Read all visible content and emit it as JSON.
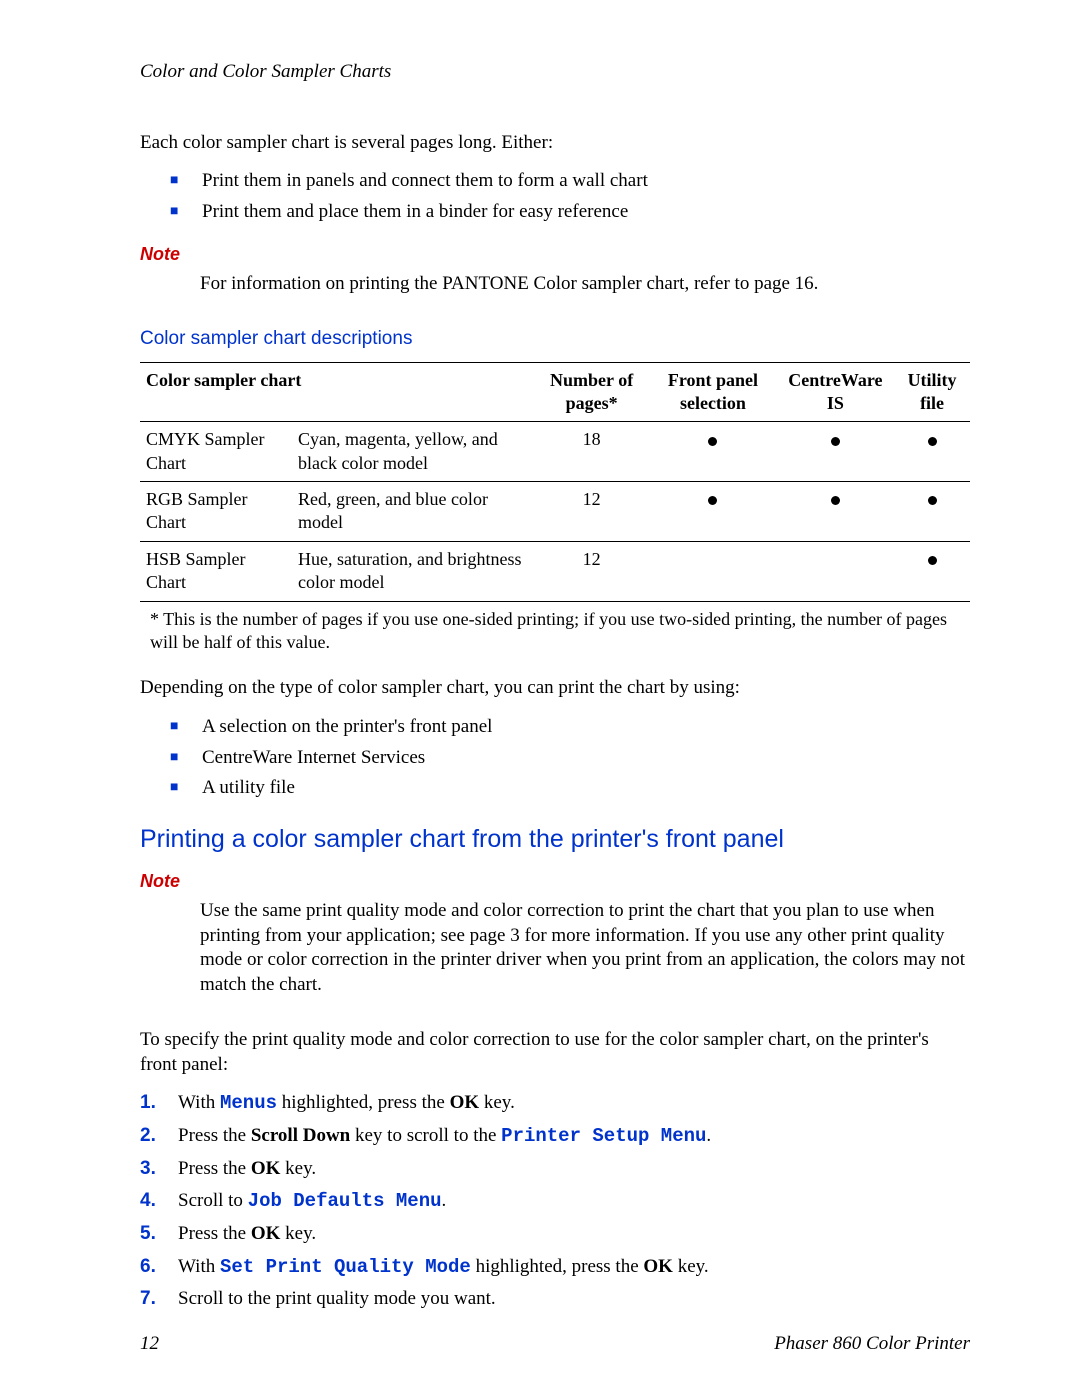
{
  "runningHead": "Color and Color Sampler Charts",
  "intro": "Each color sampler chart is several pages long. Either:",
  "introBullets": [
    "Print them in panels and connect them to form a wall chart",
    "Print them and place them in a binder for easy reference"
  ],
  "note1": {
    "label": "Note",
    "body": "For information on printing the PANTONE Color sampler chart, refer to page 16."
  },
  "tableHeading": "Color sampler chart descriptions",
  "table": {
    "headers": {
      "chart": "Color sampler chart",
      "pages": "Number of pages*",
      "front": "Front panel selection",
      "cw": "CentreWare IS",
      "util": "Utility file"
    },
    "rows": [
      {
        "name": "CMYK Sampler Chart",
        "desc": "Cyan, magenta, yellow, and black color model",
        "pages": "18",
        "front": true,
        "cw": true,
        "util": true
      },
      {
        "name": "RGB Sampler Chart",
        "desc": "Red, green, and blue color model",
        "pages": "12",
        "front": true,
        "cw": true,
        "util": true
      },
      {
        "name": "HSB Sampler Chart",
        "desc": "Hue, saturation, and brightness color model",
        "pages": "12",
        "front": false,
        "cw": false,
        "util": true
      }
    ],
    "footnote": "* This is the number of pages if you use one-sided printing; if you use two-sided printing, the number of pages will be half of this value."
  },
  "depend": "Depending on the type of color sampler chart, you can print the chart by using:",
  "dependBullets": [
    "A selection on the printer's front panel",
    "CentreWare Internet Services",
    "A utility file"
  ],
  "sectionHead": "Printing a color sampler chart from the printer's front panel",
  "note2": {
    "label": "Note",
    "body": "Use the same print quality mode and color correction to print the chart that you plan to use when printing from your application; see page 3 for more information. If you use any other print quality mode or color correction in the printer driver when you print from an application, the colors may not match the chart."
  },
  "specify": "To specify the print quality mode and color correction to use for the color sampler chart, on the printer's front panel:",
  "steps": {
    "s1a": "With ",
    "s1m": "Menus",
    "s1b": " highlighted, press the ",
    "s1c": "OK",
    "s1d": " key.",
    "s2a": "Press the ",
    "s2b": "Scroll Down",
    "s2c": " key to scroll to the ",
    "s2m": "Printer Setup Menu",
    "s2d": ".",
    "s3a": "Press the ",
    "s3b": "OK",
    "s3c": " key.",
    "s4a": "Scroll to ",
    "s4m": "Job Defaults Menu",
    "s4b": ".",
    "s5a": "Press the ",
    "s5b": "OK",
    "s5c": " key.",
    "s6a": "With ",
    "s6m": "Set Print Quality Mode",
    "s6b": " highlighted, press the ",
    "s6c": "OK",
    "s6d": " key.",
    "s7": "Scroll to the print quality mode you want."
  },
  "footer": {
    "page": "12",
    "title": "Phaser 860 Color Printer"
  }
}
